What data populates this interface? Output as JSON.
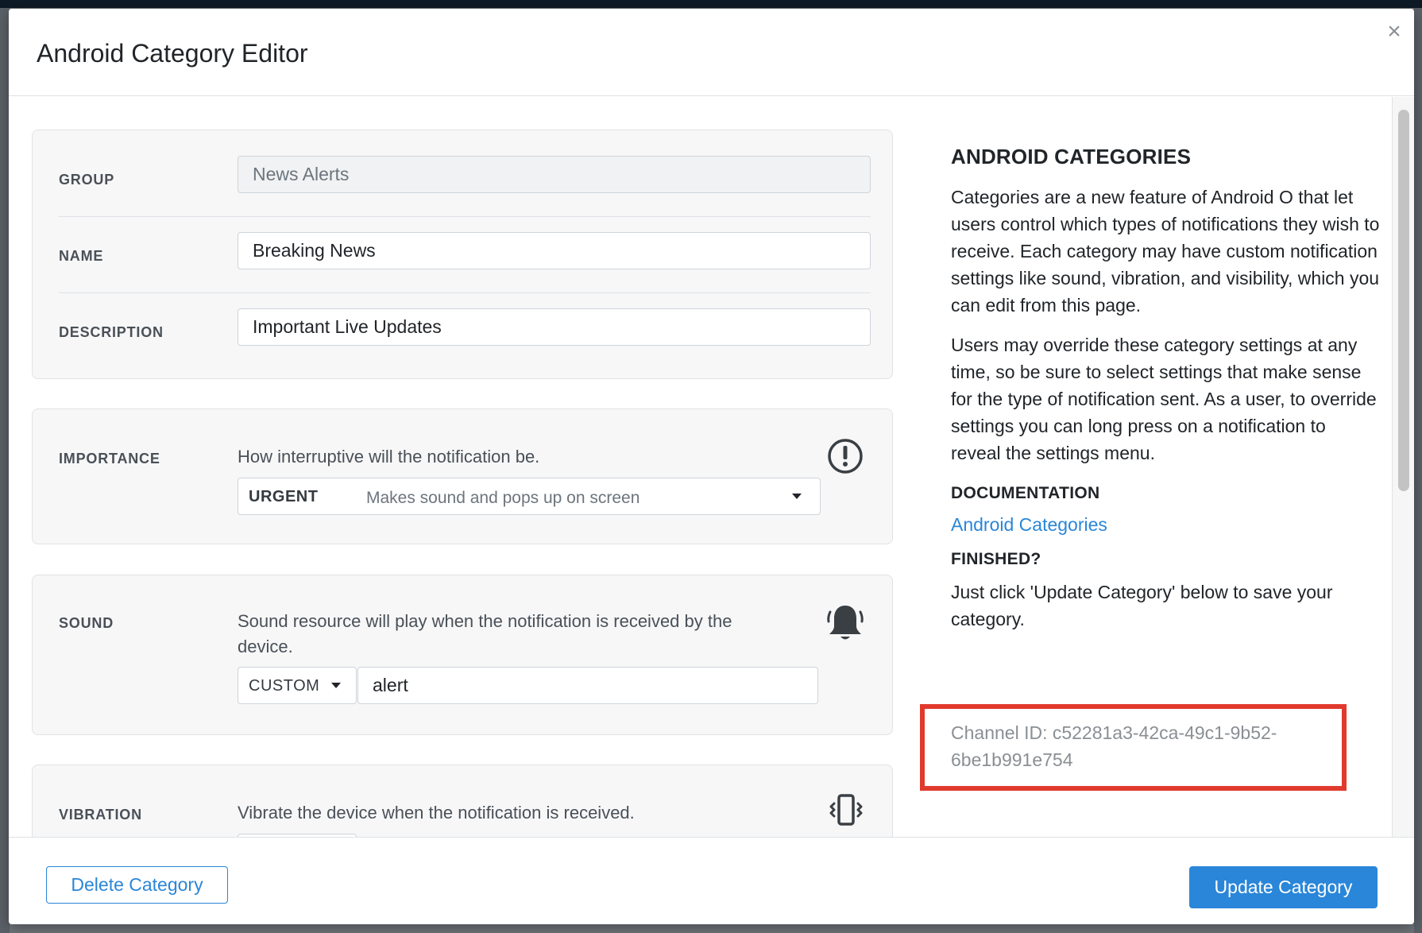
{
  "modal": {
    "title": "Android Category Editor",
    "close_label": "×"
  },
  "fields": {
    "group": {
      "label": "GROUP",
      "value": "News Alerts"
    },
    "name": {
      "label": "NAME",
      "value": "Breaking News"
    },
    "description": {
      "label": "DESCRIPTION",
      "value": "Important Live Updates"
    }
  },
  "importance": {
    "label": "IMPORTANCE",
    "hint": "How interruptive will the notification be.",
    "selected_level": "URGENT",
    "selected_description": "Makes sound and pops up on screen",
    "icon": "exclamation-circle-icon"
  },
  "sound": {
    "label": "SOUND",
    "hint_line1": "Sound resource will play when the notification is received by the",
    "hint_line2": "device.",
    "mode": "CUSTOM",
    "value": "alert",
    "icon": "bell-icon"
  },
  "vibration": {
    "label": "VIBRATION",
    "hint": "Vibrate the device when the notification is received.",
    "icon": "vibrating-phone-icon"
  },
  "side": {
    "heading": "ANDROID CATEGORIES",
    "para1": "Categories are a new feature of Android O that let users control which types of notifications they wish to receive. Each category may have custom notification settings like sound, vibration, and visibility, which you can edit from this page.",
    "para2": "Users may override these category settings at any time, so be sure to select settings that make sense for the type of notification sent. As a user, to override settings you can long press on a notification to reveal the settings menu.",
    "doc_heading": "DOCUMENTATION",
    "doc_link": "Android Categories",
    "finished_heading": "FINISHED?",
    "finished_text": "Just click 'Update Category' below to save your category.",
    "channel_id": "Channel ID: c52281a3-42ca-49c1-9b52-6be1b991e754"
  },
  "footer": {
    "delete_label": "Delete Category",
    "update_label": "Update Category"
  },
  "colors": {
    "accent": "#2a86d8",
    "highlight_box": "#e03a2d"
  }
}
